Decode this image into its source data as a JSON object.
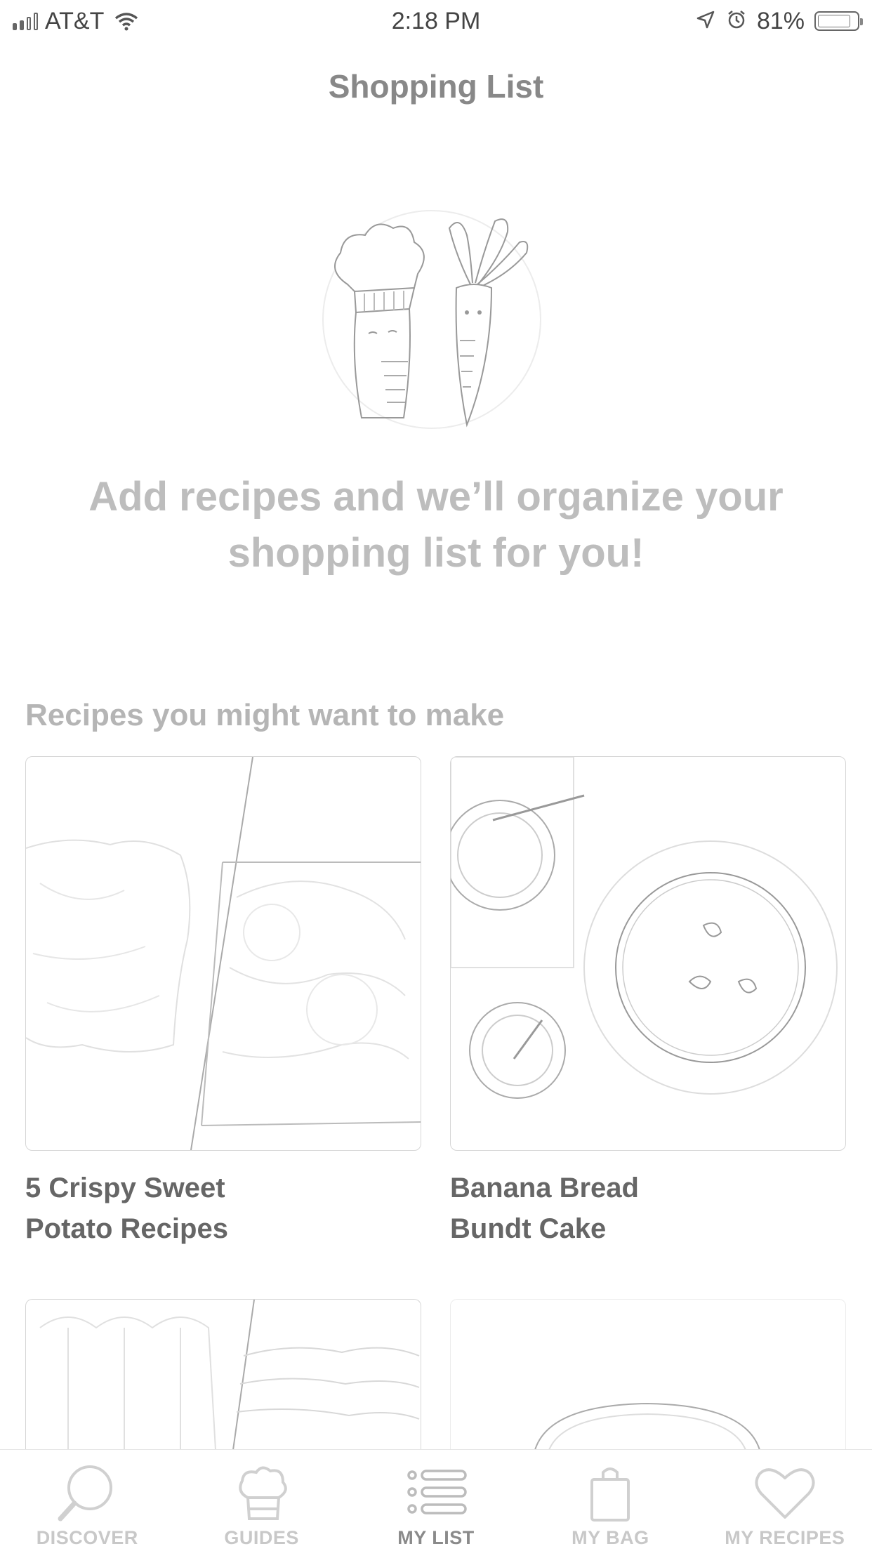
{
  "status_bar": {
    "carrier": "AT&T",
    "time": "2:18 PM",
    "battery": "81%",
    "battery_level": 0.81
  },
  "header": {
    "title": "Shopping List"
  },
  "empty_state": {
    "illustration": "chef-and-carrot-illustration",
    "message": "Add recipes and we’ll organize your shopping list for you!"
  },
  "suggestions": {
    "section_title": "Recipes you might want to make",
    "cards": [
      {
        "title": "5 Crispy Sweet Potato Recipes"
      },
      {
        "title": "Banana Bread Bundt Cake"
      },
      {
        "title": ""
      },
      {
        "title": ""
      }
    ]
  },
  "tab_bar": {
    "active": "MY LIST",
    "tabs": [
      {
        "label": "DISCOVER",
        "icon": "search-icon"
      },
      {
        "label": "GUIDES",
        "icon": "chef-hat-icon"
      },
      {
        "label": "MY LIST",
        "icon": "list-icon"
      },
      {
        "label": "MY BAG",
        "icon": "bag-icon"
      },
      {
        "label": "MY RECIPES",
        "icon": "heart-icon"
      }
    ]
  }
}
